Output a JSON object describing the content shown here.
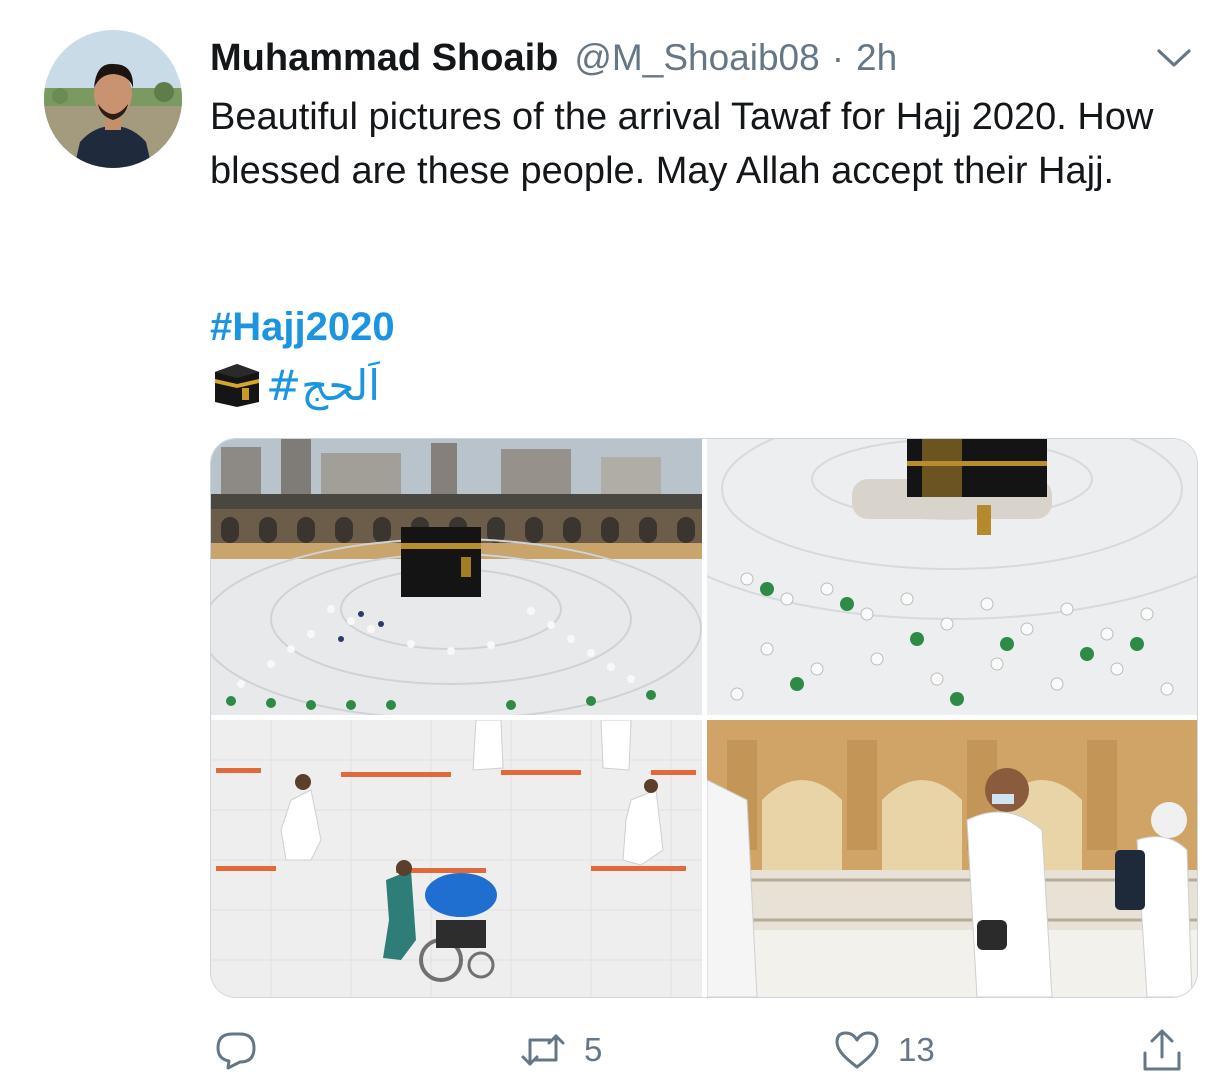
{
  "tweet": {
    "author": {
      "display_name": "Muhammad Shoaib",
      "handle": "@M_Shoaib08",
      "separator": "·",
      "time": "2h"
    },
    "text": "Beautiful pictures of the arrival Tawaf for Hajj 2020. How blessed are these people. May Allah accept their Hajj.",
    "hashtag": "#Hajj2020",
    "urdu_hashtag": "#اَلحج",
    "icons": {
      "menu": "chevron-down-icon",
      "kaaba": "kaaba-emoji",
      "reply": "reply-icon",
      "retweet": "retweet-icon",
      "like": "heart-icon",
      "share": "share-icon"
    },
    "media": {
      "count": 4
    },
    "actions": {
      "reply_count": "",
      "retweet_count": "5",
      "like_count": "13"
    },
    "colors": {
      "text": "#14171a",
      "secondary": "#657786",
      "link": "#1b95e0"
    }
  }
}
